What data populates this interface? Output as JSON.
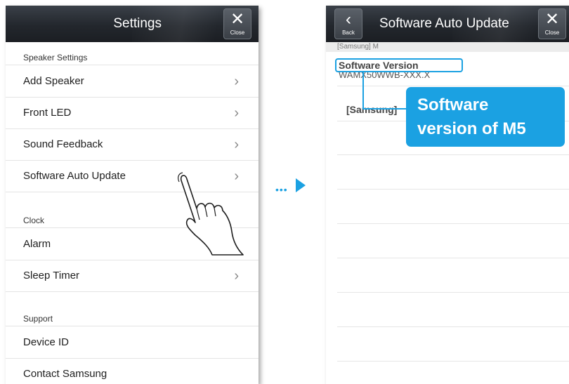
{
  "left_screen": {
    "title": "Settings",
    "close_glyph": "✕",
    "close_label": "Close",
    "sections": [
      {
        "header": "Speaker Settings",
        "items": [
          {
            "label": "Add Speaker",
            "chevron": "›"
          },
          {
            "label": "Front LED",
            "chevron": "›"
          },
          {
            "label": "Sound Feedback",
            "chevron": "›"
          },
          {
            "label": "Software Auto Update",
            "chevron": "›"
          }
        ]
      },
      {
        "header": "Clock",
        "items": [
          {
            "label": "Alarm",
            "chevron": ""
          },
          {
            "label": "Sleep Timer",
            "chevron": "›"
          }
        ]
      },
      {
        "header": "Support",
        "items": [
          {
            "label": "Device ID",
            "chevron": ""
          },
          {
            "label": "Contact Samsung",
            "chevron": ""
          }
        ]
      }
    ]
  },
  "right_screen": {
    "title": "Software Auto Update",
    "back_glyph": "‹",
    "back_label": "Back",
    "close_glyph": "✕",
    "close_label": "Close",
    "sub_header": "[Samsung] M",
    "software_version_label": "Software Version",
    "software_version_value": "WAMX50WWB-XXX.X",
    "samsung_row_label": "[Samsung]"
  },
  "callout": {
    "line1": "Software",
    "line2": "version of M5"
  },
  "colors": {
    "accent": "#1ba1e2",
    "titlebar": "#23272d"
  },
  "icons": {
    "transition": "dotted-arrow-right-icon",
    "gesture": "tapping-hand-icon"
  }
}
